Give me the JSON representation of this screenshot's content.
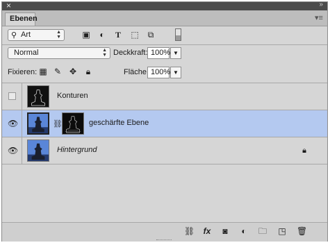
{
  "panel": {
    "tab_label": "Ebenen"
  },
  "filter": {
    "label": "Art",
    "icons": [
      "image-filter-icon",
      "adjustment-filter-icon",
      "type-filter-icon",
      "shape-filter-icon",
      "smart-object-filter-icon"
    ]
  },
  "blend": {
    "mode": "Normal",
    "opacity_label": "Deckkraft:",
    "opacity_value": "100%",
    "lock_label": "Fixieren:",
    "fill_label": "Fläche:",
    "fill_value": "100%"
  },
  "layers": [
    {
      "name": "Konturen",
      "visible": false,
      "italic": false
    },
    {
      "name": "geschärfte Ebene",
      "visible": true,
      "selected": true,
      "italic": false
    },
    {
      "name": "Hintergrund",
      "visible": true,
      "italic": true,
      "locked": true
    }
  ],
  "colors": {
    "panel_bg": "#d6d6d6",
    "selection": "#b4c9f0",
    "titlebar": "#4b4b4b"
  }
}
